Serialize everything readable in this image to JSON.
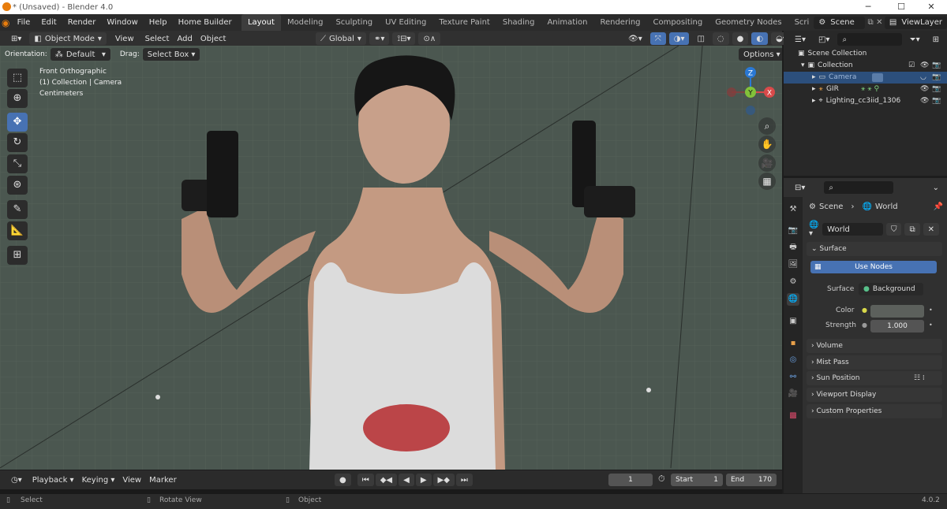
{
  "window": {
    "title": "* (Unsaved) - Blender 4.0"
  },
  "menu": [
    "File",
    "Edit",
    "Render",
    "Window",
    "Help",
    "Home Builder"
  ],
  "workspaces": [
    "Layout",
    "Modeling",
    "Sculpting",
    "UV Editing",
    "Texture Paint",
    "Shading",
    "Animation",
    "Rendering",
    "Compositing",
    "Geometry Nodes",
    "Scri"
  ],
  "active_workspace": "Layout",
  "scene": {
    "label": "Scene",
    "view_layer": "ViewLayer"
  },
  "viewport_header": {
    "mode": "Object Mode",
    "view": "View",
    "select": "Select",
    "add": "Add",
    "object": "Object",
    "transform": "Global"
  },
  "tool_header": {
    "orientation_label": "Orientation:",
    "orientation": "Default",
    "drag_label": "Drag:",
    "drag": "Select Box",
    "options": "Options"
  },
  "overlay_text": {
    "view": "Front Orthographic",
    "collection": "(1) Collection | Camera",
    "units": "Centimeters"
  },
  "gizmo": {
    "z": "Z",
    "y": "Y",
    "x": "X"
  },
  "timeline": {
    "playback": "Playback",
    "keying": "Keying",
    "view": "View",
    "marker": "Marker",
    "current_frame": "1",
    "start_label": "Start",
    "start": "1",
    "end_label": "End",
    "end": "170"
  },
  "status": {
    "select": "Select",
    "rotate": "Rotate View",
    "object": "Object",
    "version": "4.0.2"
  },
  "outliner": {
    "root": "Scene Collection",
    "collection": "Collection",
    "items": [
      {
        "name": "Camera"
      },
      {
        "name": "GIR"
      },
      {
        "name": "Lighting_cc3iid_1306"
      }
    ]
  },
  "properties": {
    "breadcrumb_scene": "Scene",
    "breadcrumb_world": "World",
    "world_name": "World",
    "surface_section": "Surface",
    "use_nodes": "Use Nodes",
    "surface_label": "Surface",
    "surface_value": "Background",
    "color_label": "Color",
    "strength_label": "Strength",
    "strength_value": "1.000",
    "sections": [
      "Volume",
      "Mist Pass",
      "Sun Position",
      "Viewport Display",
      "Custom Properties"
    ]
  },
  "colors": {
    "accent": "#4772b3",
    "viewport_bg": "#4b5750",
    "panel": "#303030"
  }
}
